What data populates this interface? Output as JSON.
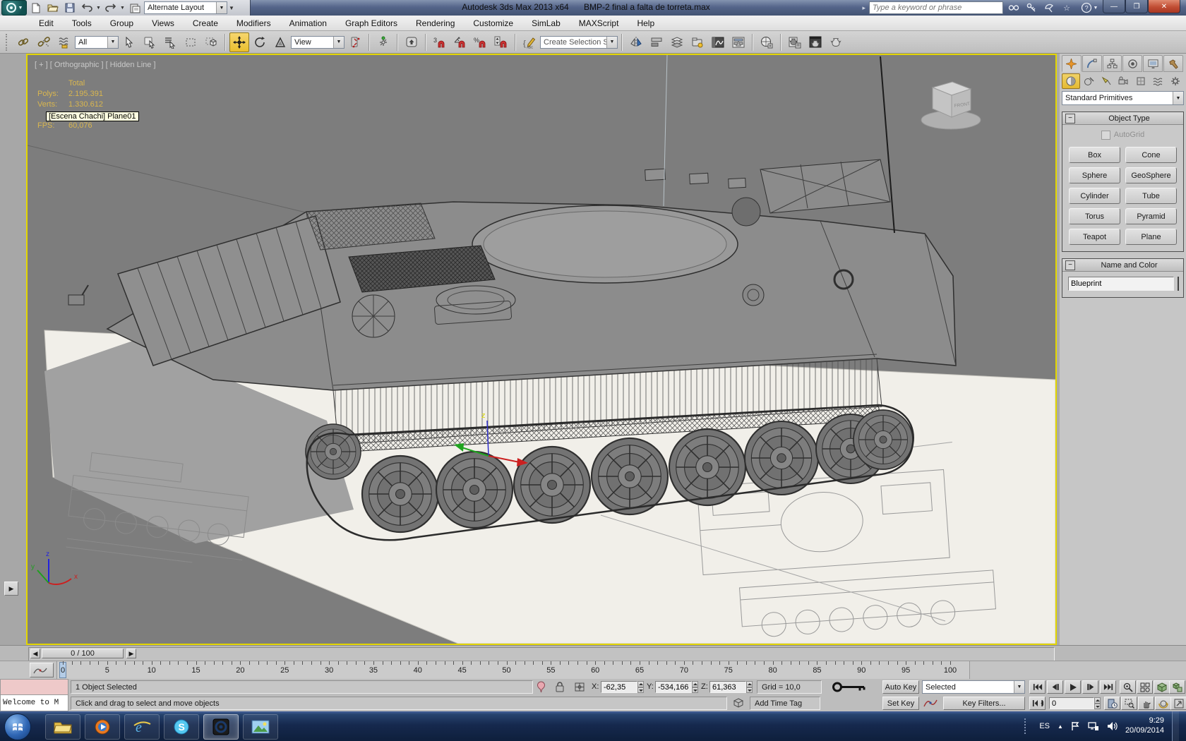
{
  "window": {
    "app_title": "Autodesk 3ds Max 2013 x64",
    "document_title": "BMP-2 final a falta de torreta.max",
    "workspace": "Alternate Layout",
    "search_placeholder": "Type a keyword or phrase"
  },
  "menus": [
    "Edit",
    "Tools",
    "Group",
    "Views",
    "Create",
    "Modifiers",
    "Animation",
    "Graph Editors",
    "Rendering",
    "Customize",
    "SimLab",
    "MAXScript",
    "Help"
  ],
  "toolbar": {
    "selection_filter": "All",
    "coordinate_system": "View",
    "selection_set_placeholder": "Create Selection Se"
  },
  "viewport": {
    "label": "[ + ] [ Orthographic ] [ Hidden Line ]",
    "stats": {
      "total_label": "Total",
      "polys_label": "Polys:",
      "polys": "2.195.391",
      "verts_label": "Verts:",
      "verts": "1.330.612",
      "fps_label": "FPS:",
      "fps": "60,076"
    },
    "tooltip": "[Escena Chachi] Plane01",
    "viewcube_face": "FRONT",
    "axis": {
      "x": "x",
      "y": "y",
      "z": "z"
    },
    "gizmo_axis_label": "z"
  },
  "command_panel": {
    "category_dropdown": "Standard Primitives",
    "object_type": {
      "title": "Object Type",
      "autogrid_label": "AutoGrid",
      "buttons": [
        "Box",
        "Cone",
        "Sphere",
        "GeoSphere",
        "Cylinder",
        "Tube",
        "Torus",
        "Pyramid",
        "Teapot",
        "Plane"
      ]
    },
    "name_and_color": {
      "title": "Name and Color",
      "object_name": "Blueprint",
      "object_color": "#3e7fc0"
    }
  },
  "timeline": {
    "time_display": "0 / 100",
    "tick_labels": [
      "0",
      "5",
      "10",
      "15",
      "20",
      "25",
      "30",
      "35",
      "40",
      "45",
      "50",
      "55",
      "60",
      "65",
      "70",
      "75",
      "80",
      "85",
      "90",
      "95",
      "100"
    ]
  },
  "status_bar": {
    "selection_status": "1 Object Selected",
    "prompt": "Click and drag to select and move objects",
    "maxscript_listener": "Welcome to M",
    "x_label": "X:",
    "x_value": "-62,35",
    "y_label": "Y:",
    "y_value": "-534,166",
    "z_label": "Z:",
    "z_value": "61,363",
    "grid_display": "Grid = 10,0",
    "auto_key_label": "Auto Key",
    "set_key_label": "Set Key",
    "key_mode": "Selected",
    "key_filters_label": "Key Filters...",
    "add_time_tag": "Add Time Tag",
    "current_frame": "0"
  },
  "taskbar": {
    "language": "ES",
    "clock_time": "9:29",
    "clock_date": "20/09/2014"
  }
}
